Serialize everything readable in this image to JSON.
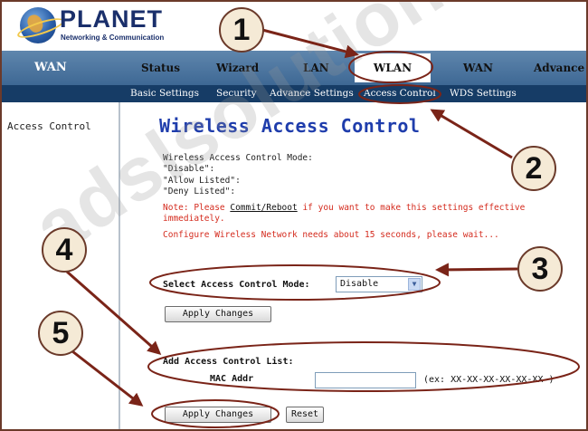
{
  "brand": {
    "name": "PLANET",
    "tagline": "Networking & Communication"
  },
  "main_nav": {
    "wan1": "WAN",
    "status": "Status",
    "wizard": "Wizard",
    "lan": "LAN",
    "wlan": "WLAN",
    "wan2": "WAN",
    "advance": "Advance"
  },
  "sub_nav": {
    "basic": "Basic Settings",
    "security": "Security",
    "advance": "Advance Settings",
    "access": "Access Control",
    "wds": "WDS Settings"
  },
  "sidebar": {
    "item": "Access Control"
  },
  "page": {
    "title": "Wireless Access Control",
    "mode_header": "Wireless Access Control Mode:",
    "mode_disable": "\"Disable\":",
    "mode_allow": "\"Allow Listed\":",
    "mode_deny": "\"Deny Listed\":",
    "note_prefix": "Note: Please ",
    "note_link": "Commit/Reboot",
    "note_suffix": " if you want to make this settings effective immediately.",
    "configure": "Configure Wireless Network needs about 15 seconds, please wait...",
    "select_label": "Select Access Control Mode:",
    "select_value": "Disable",
    "apply_label": "Apply Changes",
    "add_label": "Add Access Control List:",
    "mac_label": "MAC Addr",
    "mac_value": "",
    "mac_hint": "(ex: XX-XX-XX-XX-XX-XX )",
    "apply2_label": "Apply Changes",
    "reset_label": "Reset"
  },
  "annotations": {
    "m1": "1",
    "m2": "2",
    "m3": "3",
    "m4": "4",
    "m5": "5",
    "color": "#7a2418"
  },
  "watermark": "adslsolution"
}
